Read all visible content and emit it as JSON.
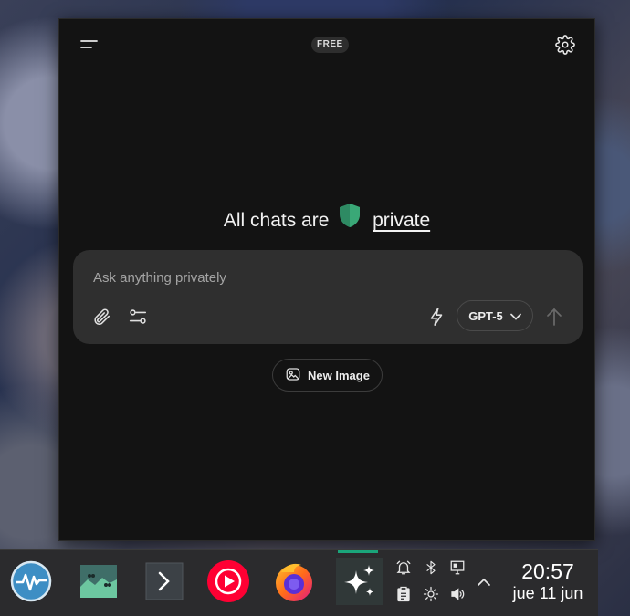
{
  "header": {
    "menu_icon": "hamburger-menu-icon",
    "plan_badge": "FREE",
    "settings_icon": "gear-icon"
  },
  "hero": {
    "text_before": "All chats are",
    "shield_icon": "shield-icon",
    "link_text": "private",
    "shield_color": "#2e8a63"
  },
  "composer": {
    "placeholder": "Ask anything privately",
    "value": "",
    "attach_icon": "paperclip-icon",
    "tools_icon": "sliders-icon",
    "speed_icon": "lightning-icon",
    "model_label": "GPT-5",
    "send_icon": "arrow-up-icon"
  },
  "actions": {
    "new_image_label": "New Image",
    "new_image_icon": "image-icon"
  },
  "taskbar": {
    "apps": [
      "system-monitor-icon",
      "image-viewer-icon",
      "terminal-icon",
      "youtube-music-icon",
      "firefox-icon",
      "ai-sparkle-icon"
    ],
    "tray_icons": [
      "alarm-icon",
      "bluetooth-icon",
      "display-icon",
      "clipboard-icon",
      "brightness-icon",
      "volume-icon",
      "chevron-up-icon"
    ],
    "clock_time": "20:57",
    "clock_date": "jue 11 jun",
    "accent_color": "#1aa57a"
  }
}
